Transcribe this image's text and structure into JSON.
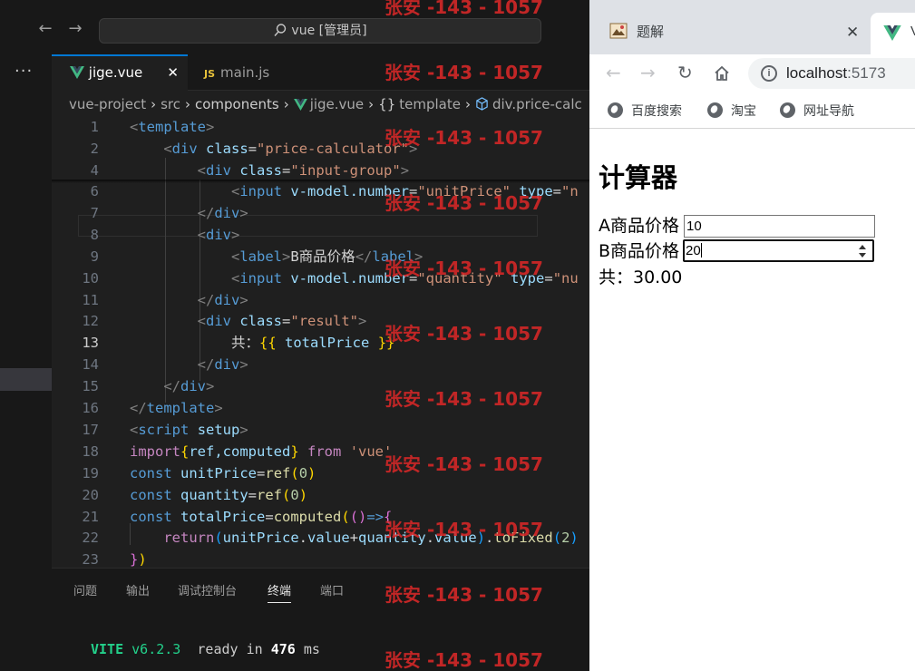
{
  "vscode": {
    "search_text": "vue [管理员]",
    "tabs": [
      {
        "label": "jige.vue",
        "active": true,
        "close": "✕"
      },
      {
        "label": "main.js",
        "active": false,
        "badge": "JS"
      }
    ],
    "breadcrumb": [
      "vue-project",
      "src",
      "components",
      "jige.vue",
      "template",
      "div.price-calc"
    ],
    "breadcrumb_icons": {
      "template": "{}",
      "div": "cube-icon"
    },
    "more_label": "···",
    "code_lines": [
      {
        "n": "1"
      },
      {
        "n": "2"
      },
      {
        "n": "4"
      },
      {
        "n": "6"
      },
      {
        "n": "7"
      },
      {
        "n": "8"
      },
      {
        "n": "9"
      },
      {
        "n": "10"
      },
      {
        "n": "11"
      },
      {
        "n": "12"
      },
      {
        "n": "13"
      },
      {
        "n": "14"
      },
      {
        "n": "15"
      },
      {
        "n": "16"
      },
      {
        "n": "17"
      },
      {
        "n": "18"
      },
      {
        "n": "19"
      },
      {
        "n": "20"
      },
      {
        "n": "21"
      },
      {
        "n": "22"
      },
      {
        "n": "23"
      }
    ],
    "code": {
      "l1_tag": "template",
      "l2_tag": "div",
      "l2_attr": "class",
      "l2_val": "\"price-calculator\"",
      "l4_tag": "div",
      "l4_attr": "class",
      "l4_val": "\"input-group\"",
      "l6_tag": "input",
      "l6_attr": "v-model.number",
      "l6_val": "\"unitPrice\"",
      "l6_attr2": "type",
      "l6_val2": "\"n",
      "l7_tag": "div",
      "l8_tag": "div",
      "l9_tag": "label",
      "l9_text": "B商品价格",
      "l10_tag": "input",
      "l10_attr": "v-model.number",
      "l10_val": "\"quantity\"",
      "l10_attr2": "type",
      "l10_val2": "\"nu",
      "l11_tag": "div",
      "l12_tag": "div",
      "l12_attr": "class",
      "l12_val": "\"result\"",
      "l13_text": "共：",
      "l13_expr": "totalPrice",
      "l14_tag": "div",
      "l15_tag": "div",
      "l16_tag": "template",
      "l17_tag": "script",
      "l17_attr": "setup",
      "l18_kw": "import",
      "l18_names": "ref,computed",
      "l18_from": "from",
      "l18_mod": "'vue'",
      "l19_kw": "const",
      "l19_var": "unitPrice",
      "l19_fn": "ref",
      "l19_num": "0",
      "l20_kw": "const",
      "l20_var": "quantity",
      "l20_fn": "ref",
      "l20_num": "0",
      "l21_kw": "const",
      "l21_var": "totalPrice",
      "l21_fn": "computed",
      "l22_kw": "return",
      "l22_a": "unitPrice",
      "l22_b": "value",
      "l22_c": "quantity",
      "l22_d": "value",
      "l22_fn": "toFixed",
      "l22_num": "2"
    },
    "panel_tabs": [
      "问题",
      "输出",
      "调试控制台",
      "终端",
      "端口"
    ],
    "active_panel_tab": "终端",
    "terminal": {
      "vite": "VITE",
      "version": "v6.2.3",
      "ready": "ready in",
      "ms_value": "476",
      "ms_unit": "ms"
    }
  },
  "browser": {
    "tab_title": "题解",
    "tab_close": "✕",
    "tab2_letter": "V",
    "url_host": "localhost",
    "url_port": ":5173",
    "bookmarks": [
      "百度搜索",
      "淘宝",
      "网址导航"
    ],
    "page": {
      "heading": "计算器",
      "label_a": "A商品价格",
      "value_a": "10",
      "label_b": "B商品价格",
      "value_b": "20",
      "result": "共：30.00"
    }
  },
  "watermark_text": "张安 -143 - 1057",
  "colors": {
    "accent": "#0078d4",
    "watermark": "#d82828",
    "vue_green": "#42b883"
  }
}
